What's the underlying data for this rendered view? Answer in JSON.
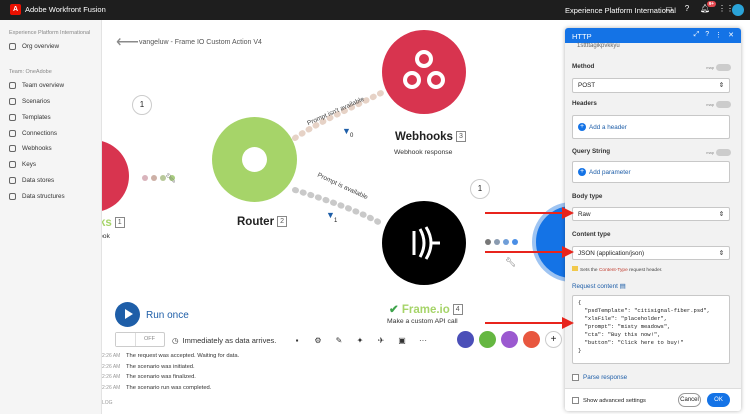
{
  "topbar": {
    "app_title": "Adobe Workfront Fusion",
    "logo_letter": "A",
    "org_name": "Experience Platform International",
    "notif_badge": "9+",
    "icons": [
      "chat-icon",
      "help-icon",
      "bell-icon",
      "apps-grid-icon"
    ]
  },
  "sidebar": {
    "org_section": "Experience Platform International",
    "org_items": [
      {
        "label": "Org overview",
        "icon": "org-icon"
      }
    ],
    "team_section": "Team: OneAdobe",
    "team_items": [
      {
        "label": "Team overview",
        "icon": "team-overview-icon"
      },
      {
        "label": "Scenarios",
        "icon": "scenarios-icon"
      },
      {
        "label": "Templates",
        "icon": "templates-icon"
      },
      {
        "label": "Connections",
        "icon": "connections-icon"
      },
      {
        "label": "Webhooks",
        "icon": "webhooks-icon"
      },
      {
        "label": "Keys",
        "icon": "keys-icon"
      },
      {
        "label": "Data stores",
        "icon": "data-stores-icon"
      },
      {
        "label": "Data structures",
        "icon": "data-structures-icon"
      }
    ]
  },
  "scenario": {
    "title": "vangeluw - Frame IO Custom Action V4",
    "nodes": {
      "left": {
        "name": "ks",
        "num": "1",
        "sub": "ook",
        "count": "1"
      },
      "router": {
        "name": "Router",
        "num": "2"
      },
      "webhooks": {
        "name": "Webhooks",
        "num": "3",
        "sub": "Webhook response"
      },
      "frameio": {
        "name": "Frame.io",
        "num": "4",
        "sub": "Make a custom API call",
        "count": "1"
      }
    },
    "routes": {
      "top_label": "Prompt isn't available",
      "top_count": "0",
      "bottom_label": "Prompt is available",
      "bottom_count": "1"
    },
    "colors": {
      "router": "#a6d469",
      "webhooks": "#d8344f",
      "frameio": "#000000",
      "accent": "#1e5ea8",
      "arrow": "#e8241c"
    }
  },
  "controls": {
    "run_once": "Run once",
    "toggle_state": "OFF",
    "schedule": "Immediately as data arrives.",
    "toolbar_icons": [
      "save-icon",
      "settings-icon",
      "auto-align-icon",
      "magic-wand-icon",
      "plane-icon",
      "briefcase-icon",
      "more-icon"
    ]
  },
  "log": {
    "rows": [
      {
        "time": "2:26 AM",
        "text": "The request was accepted. Waiting for data."
      },
      {
        "time": "2:26 AM",
        "text": "The scenario was initiated."
      },
      {
        "time": "2:26 AM",
        "text": "The scenario was finalized."
      },
      {
        "time": "2:26 AM",
        "text": "The scenario run was completed."
      }
    ],
    "more": "LOG"
  },
  "panel": {
    "title": "HTTP",
    "top_value": "1sttttagikpvkkyu",
    "method_label": "Method",
    "method_value": "POST",
    "map_label": "map",
    "headers_label": "Headers",
    "add_header": "Add a header",
    "query_label": "Query String",
    "add_param": "Add parameter",
    "body_type_label": "Body type",
    "body_type_value": "Raw",
    "content_type_label": "Content type",
    "content_type_value": "JSON (application/json)",
    "content_hint_pre": "Sets the ",
    "content_hint_code": "Content-Type",
    "content_hint_post": " request header.",
    "request_content_label": "Request content",
    "request_content": "{\n  \"psdTemplate\": \"citisignal-fiber.psd\",\n  \"xlsFile\": \"placeholder\",\n  \"prompt\": \"misty meadows\",\n  \"cta\": \"Buy this now!\",\n  \"button\": \"Click here to buy!\"\n}",
    "parse_response": "Parse response",
    "show_advanced": "Show advanced settings",
    "cancel": "Cancel",
    "ok": "OK"
  }
}
